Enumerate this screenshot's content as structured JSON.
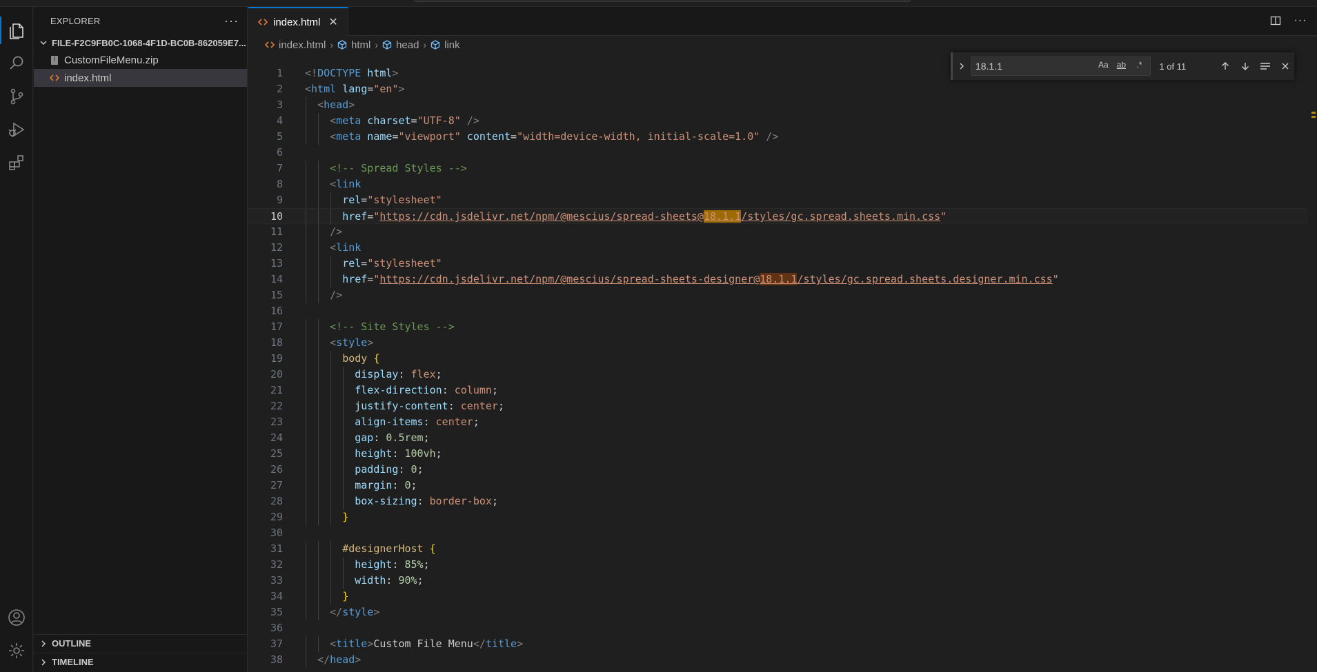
{
  "sidebar": {
    "title": "EXPLORER",
    "more_icon": "ellipsis-icon",
    "folder": "FILE-F2C9FB0C-1068-4F1D-BC0B-862059E7...",
    "files": [
      {
        "name": "CustomFileMenu.zip",
        "icon": "zip-file-icon"
      },
      {
        "name": "index.html",
        "icon": "html-file-icon",
        "selected": true
      }
    ],
    "sections": [
      "OUTLINE",
      "TIMELINE"
    ]
  },
  "activity_bar": [
    "explorer-icon",
    "search-icon",
    "source-control-icon",
    "run-debug-icon",
    "extensions-icon",
    "account-icon",
    "settings-gear-icon"
  ],
  "tab": {
    "label": "index.html",
    "close": "✕"
  },
  "breadcrumb": [
    "index.html",
    "html",
    "head",
    "link"
  ],
  "find": {
    "query": "18.1.1",
    "opt_case": "Aa",
    "opt_word": "ab",
    "opt_regex": ".*",
    "count": "1 of 11"
  },
  "code": {
    "line_numbers": [
      "1",
      "2",
      "3",
      "4",
      "5",
      "6",
      "7",
      "8",
      "9",
      "10",
      "11",
      "12",
      "13",
      "14",
      "15",
      "16",
      "17",
      "18",
      "19",
      "20",
      "21",
      "22",
      "23",
      "24",
      "25",
      "26",
      "27",
      "28",
      "29",
      "30",
      "31",
      "32",
      "33",
      "34",
      "35",
      "36",
      "37",
      "38"
    ],
    "current_line": 10,
    "lines": [
      [
        {
          "t": "<!",
          "c": "punct"
        },
        {
          "t": "DOCTYPE",
          "c": "tag"
        },
        {
          "t": " html",
          "c": "attr"
        },
        {
          "t": ">",
          "c": "punct"
        }
      ],
      [
        {
          "t": "<",
          "c": "punct"
        },
        {
          "t": "html",
          "c": "tag"
        },
        {
          "t": " lang",
          "c": "attr"
        },
        {
          "t": "=",
          "c": "text"
        },
        {
          "t": "\"en\"",
          "c": "str"
        },
        {
          "t": ">",
          "c": "punct"
        }
      ],
      [
        {
          "t": "  "
        },
        {
          "t": "<",
          "c": "punct"
        },
        {
          "t": "head",
          "c": "tag"
        },
        {
          "t": ">",
          "c": "punct"
        }
      ],
      [
        {
          "t": "    "
        },
        {
          "t": "<",
          "c": "punct"
        },
        {
          "t": "meta",
          "c": "tag"
        },
        {
          "t": " charset",
          "c": "attr"
        },
        {
          "t": "=",
          "c": "text"
        },
        {
          "t": "\"UTF-8\"",
          "c": "str"
        },
        {
          "t": " />",
          "c": "punct"
        }
      ],
      [
        {
          "t": "    "
        },
        {
          "t": "<",
          "c": "punct"
        },
        {
          "t": "meta",
          "c": "tag"
        },
        {
          "t": " name",
          "c": "attr"
        },
        {
          "t": "=",
          "c": "text"
        },
        {
          "t": "\"viewport\"",
          "c": "str"
        },
        {
          "t": " content",
          "c": "attr"
        },
        {
          "t": "=",
          "c": "text"
        },
        {
          "t": "\"width=device-width, initial-scale=1.0\"",
          "c": "str"
        },
        {
          "t": " />",
          "c": "punct"
        }
      ],
      [],
      [
        {
          "t": "    "
        },
        {
          "t": "<!-- Spread Styles -->",
          "c": "cmt"
        }
      ],
      [
        {
          "t": "    "
        },
        {
          "t": "<",
          "c": "punct"
        },
        {
          "t": "link",
          "c": "tag"
        }
      ],
      [
        {
          "t": "      "
        },
        {
          "t": "rel",
          "c": "attr"
        },
        {
          "t": "=",
          "c": "text"
        },
        {
          "t": "\"stylesheet\"",
          "c": "str"
        }
      ],
      [
        {
          "t": "      "
        },
        {
          "t": "href",
          "c": "attr"
        },
        {
          "t": "=",
          "c": "text"
        },
        {
          "t": "\"",
          "c": "str"
        },
        {
          "t": "https://cdn.jsdelivr.net/npm/@mescius/spread-sheets@",
          "c": "str link"
        },
        {
          "t": "18.1.1",
          "c": "str link match cur"
        },
        {
          "t": "/styles/gc.spread.sheets.min.css",
          "c": "str link"
        },
        {
          "t": "\"",
          "c": "str"
        }
      ],
      [
        {
          "t": "    "
        },
        {
          "t": "/>",
          "c": "punct"
        }
      ],
      [
        {
          "t": "    "
        },
        {
          "t": "<",
          "c": "punct"
        },
        {
          "t": "link",
          "c": "tag"
        }
      ],
      [
        {
          "t": "      "
        },
        {
          "t": "rel",
          "c": "attr"
        },
        {
          "t": "=",
          "c": "text"
        },
        {
          "t": "\"stylesheet\"",
          "c": "str"
        }
      ],
      [
        {
          "t": "      "
        },
        {
          "t": "href",
          "c": "attr"
        },
        {
          "t": "=",
          "c": "text"
        },
        {
          "t": "\"",
          "c": "str"
        },
        {
          "t": "https://cdn.jsdelivr.net/npm/@mescius/spread-sheets-designer@",
          "c": "str link"
        },
        {
          "t": "18.1.1",
          "c": "str link match"
        },
        {
          "t": "/styles/gc.spread.sheets.designer.min.css",
          "c": "str link"
        },
        {
          "t": "\"",
          "c": "str"
        }
      ],
      [
        {
          "t": "    "
        },
        {
          "t": "/>",
          "c": "punct"
        }
      ],
      [],
      [
        {
          "t": "    "
        },
        {
          "t": "<!-- Site Styles -->",
          "c": "cmt"
        }
      ],
      [
        {
          "t": "    "
        },
        {
          "t": "<",
          "c": "punct"
        },
        {
          "t": "style",
          "c": "tag"
        },
        {
          "t": ">",
          "c": "punct"
        }
      ],
      [
        {
          "t": "      "
        },
        {
          "t": "body",
          "c": "sel"
        },
        {
          "t": " {",
          "c": "brace"
        }
      ],
      [
        {
          "t": "        "
        },
        {
          "t": "display",
          "c": "prop"
        },
        {
          "t": ": ",
          "c": "text"
        },
        {
          "t": "flex",
          "c": "val"
        },
        {
          "t": ";",
          "c": "text"
        }
      ],
      [
        {
          "t": "        "
        },
        {
          "t": "flex-direction",
          "c": "prop"
        },
        {
          "t": ": ",
          "c": "text"
        },
        {
          "t": "column",
          "c": "val"
        },
        {
          "t": ";",
          "c": "text"
        }
      ],
      [
        {
          "t": "        "
        },
        {
          "t": "justify-content",
          "c": "prop"
        },
        {
          "t": ": ",
          "c": "text"
        },
        {
          "t": "center",
          "c": "val"
        },
        {
          "t": ";",
          "c": "text"
        }
      ],
      [
        {
          "t": "        "
        },
        {
          "t": "align-items",
          "c": "prop"
        },
        {
          "t": ": ",
          "c": "text"
        },
        {
          "t": "center",
          "c": "val"
        },
        {
          "t": ";",
          "c": "text"
        }
      ],
      [
        {
          "t": "        "
        },
        {
          "t": "gap",
          "c": "prop"
        },
        {
          "t": ": ",
          "c": "text"
        },
        {
          "t": "0.5rem",
          "c": "num"
        },
        {
          "t": ";",
          "c": "text"
        }
      ],
      [
        {
          "t": "        "
        },
        {
          "t": "height",
          "c": "prop"
        },
        {
          "t": ": ",
          "c": "text"
        },
        {
          "t": "100vh",
          "c": "num"
        },
        {
          "t": ";",
          "c": "text"
        }
      ],
      [
        {
          "t": "        "
        },
        {
          "t": "padding",
          "c": "prop"
        },
        {
          "t": ": ",
          "c": "text"
        },
        {
          "t": "0",
          "c": "num"
        },
        {
          "t": ";",
          "c": "text"
        }
      ],
      [
        {
          "t": "        "
        },
        {
          "t": "margin",
          "c": "prop"
        },
        {
          "t": ": ",
          "c": "text"
        },
        {
          "t": "0",
          "c": "num"
        },
        {
          "t": ";",
          "c": "text"
        }
      ],
      [
        {
          "t": "        "
        },
        {
          "t": "box-sizing",
          "c": "prop"
        },
        {
          "t": ": ",
          "c": "text"
        },
        {
          "t": "border-box",
          "c": "val"
        },
        {
          "t": ";",
          "c": "text"
        }
      ],
      [
        {
          "t": "      "
        },
        {
          "t": "}",
          "c": "brace"
        }
      ],
      [],
      [
        {
          "t": "      "
        },
        {
          "t": "#designerHost",
          "c": "sel"
        },
        {
          "t": " {",
          "c": "brace"
        }
      ],
      [
        {
          "t": "        "
        },
        {
          "t": "height",
          "c": "prop"
        },
        {
          "t": ": ",
          "c": "text"
        },
        {
          "t": "85%",
          "c": "num"
        },
        {
          "t": ";",
          "c": "text"
        }
      ],
      [
        {
          "t": "        "
        },
        {
          "t": "width",
          "c": "prop"
        },
        {
          "t": ": ",
          "c": "text"
        },
        {
          "t": "90%",
          "c": "num"
        },
        {
          "t": ";",
          "c": "text"
        }
      ],
      [
        {
          "t": "      "
        },
        {
          "t": "}",
          "c": "brace"
        }
      ],
      [
        {
          "t": "    "
        },
        {
          "t": "</",
          "c": "punct"
        },
        {
          "t": "style",
          "c": "tag"
        },
        {
          "t": ">",
          "c": "punct"
        }
      ],
      [],
      [
        {
          "t": "    "
        },
        {
          "t": "<",
          "c": "punct"
        },
        {
          "t": "title",
          "c": "tag"
        },
        {
          "t": ">",
          "c": "punct"
        },
        {
          "t": "Custom File Menu",
          "c": "text"
        },
        {
          "t": "</",
          "c": "punct"
        },
        {
          "t": "title",
          "c": "tag"
        },
        {
          "t": ">",
          "c": "punct"
        }
      ],
      [
        {
          "t": "  "
        },
        {
          "t": "</",
          "c": "punct"
        },
        {
          "t": "head",
          "c": "tag"
        },
        {
          "t": ">",
          "c": "punct"
        }
      ]
    ]
  }
}
